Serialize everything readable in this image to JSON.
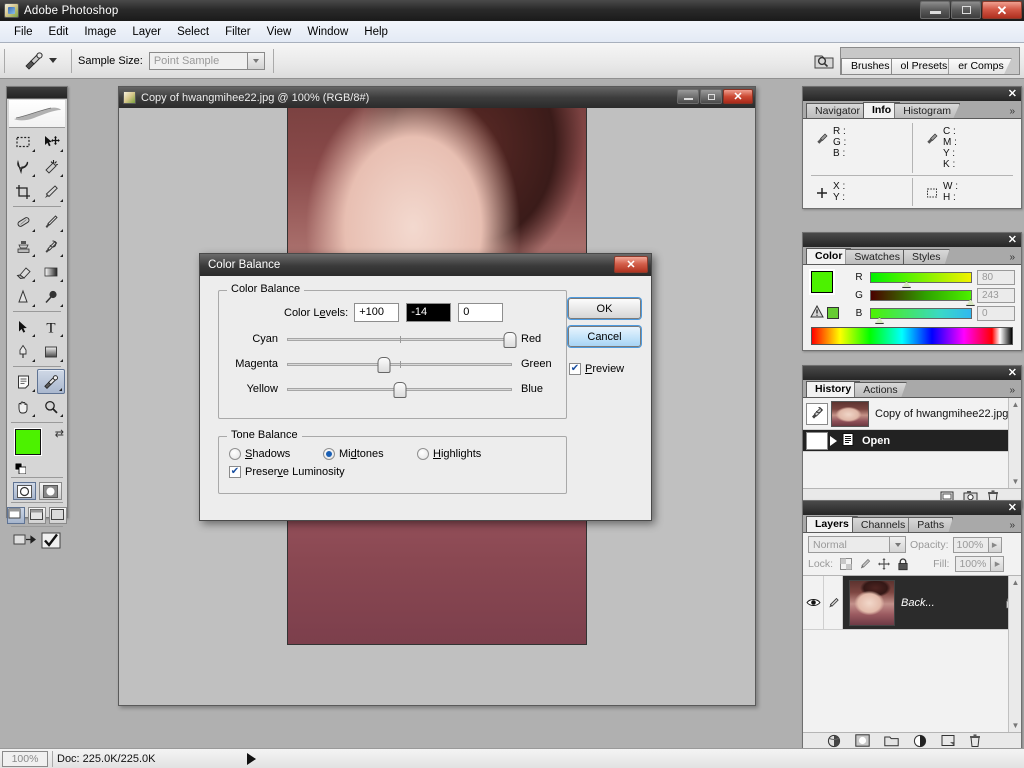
{
  "app": {
    "title": "Adobe Photoshop",
    "icon": "photoshop-icon",
    "window_controls": {
      "minimize": "minimize-icon",
      "restore": "restore-icon",
      "close": "close-icon"
    }
  },
  "menu": {
    "items": [
      {
        "label": "File"
      },
      {
        "label": "Edit"
      },
      {
        "label": "Image"
      },
      {
        "label": "Layer"
      },
      {
        "label": "Select"
      },
      {
        "label": "Filter"
      },
      {
        "label": "View"
      },
      {
        "label": "Window"
      },
      {
        "label": "Help"
      }
    ]
  },
  "options_bar": {
    "tool_icon": "eyedropper-icon",
    "sample_size_label": "Sample Size:",
    "sample_size_value": "Point Sample",
    "well_icon": "palette-well-icon",
    "well_tabs": [
      {
        "label": "Brushes"
      },
      {
        "label": "ol Presets"
      },
      {
        "label": "er Comps"
      }
    ]
  },
  "toolbox": {
    "tools": [
      {
        "name": "rectangular-marquee-tool",
        "glyph": "marquee"
      },
      {
        "name": "move-tool",
        "glyph": "move"
      },
      {
        "name": "lasso-tool",
        "glyph": "lasso"
      },
      {
        "name": "magic-wand-tool",
        "glyph": "wand"
      },
      {
        "name": "crop-tool",
        "glyph": "crop"
      },
      {
        "name": "slice-tool",
        "glyph": "slice"
      },
      {
        "name": "healing-brush-tool",
        "glyph": "heal"
      },
      {
        "name": "brush-tool",
        "glyph": "brush"
      },
      {
        "name": "clone-stamp-tool",
        "glyph": "stamp"
      },
      {
        "name": "history-brush-tool",
        "glyph": "historybrush"
      },
      {
        "name": "eraser-tool",
        "glyph": "eraser"
      },
      {
        "name": "gradient-tool",
        "glyph": "gradient"
      },
      {
        "name": "blur-tool",
        "glyph": "blur"
      },
      {
        "name": "dodge-tool",
        "glyph": "dodge"
      },
      {
        "name": "path-selection-tool",
        "glyph": "pathsel"
      },
      {
        "name": "type-tool",
        "glyph": "type"
      },
      {
        "name": "pen-tool",
        "glyph": "pen"
      },
      {
        "name": "shape-tool",
        "glyph": "shape"
      },
      {
        "name": "notes-tool",
        "glyph": "notes"
      },
      {
        "name": "eyedropper-tool",
        "glyph": "eyedropper",
        "selected": true
      },
      {
        "name": "hand-tool",
        "glyph": "hand"
      },
      {
        "name": "zoom-tool",
        "glyph": "zoom"
      }
    ],
    "foreground_color": "#4cf200",
    "background_color": "#2f7a43",
    "swap_icon": "swap-colors-icon",
    "default_icon": "default-colors-icon",
    "quickmask": [
      {
        "name": "standard-mode-button",
        "selected": true
      },
      {
        "name": "quick-mask-mode-button",
        "selected": false
      }
    ],
    "screen_modes": [
      {
        "name": "standard-screen-mode-button",
        "selected": true
      },
      {
        "name": "full-screen-menubar-button",
        "selected": false
      },
      {
        "name": "full-screen-button",
        "selected": false
      }
    ],
    "jump_buttons": [
      {
        "name": "jump-to-imageready-button"
      },
      {
        "name": "imageready-check-button"
      }
    ]
  },
  "document": {
    "title": "Copy of hwangmihee22.jpg @ 100% (RGB/8#)",
    "icon": "document-icon",
    "window_controls": {
      "minimize": "minimize-icon",
      "restore": "restore-icon",
      "close": "close-icon"
    }
  },
  "info_panel": {
    "tabs": [
      {
        "label": "Navigator",
        "active": false
      },
      {
        "label": "Info",
        "active": true
      },
      {
        "label": "Histogram",
        "active": false
      }
    ],
    "more_icon": "panel-menu-icon",
    "close_icon": "close-icon",
    "rgb": {
      "icon": "eyedropper-icon",
      "keys": [
        "R :",
        "G :",
        "B :"
      ]
    },
    "cmyk": {
      "icon": "eyedropper-icon",
      "keys": [
        "C :",
        "M :",
        "Y :",
        "K :"
      ]
    },
    "position": {
      "icon": "crosshair-icon",
      "keys": [
        "X :",
        "Y :"
      ]
    },
    "size": {
      "icon": "marquee-icon",
      "keys": [
        "W :",
        "H :"
      ]
    }
  },
  "color_panel": {
    "tabs": [
      {
        "label": "Color",
        "active": true
      },
      {
        "label": "Swatches",
        "active": false
      },
      {
        "label": "Styles",
        "active": false
      }
    ],
    "more_icon": "panel-menu-icon",
    "close_icon": "close-icon",
    "foreground_color": "#4cf200",
    "background_color": "#2f7a43",
    "gamut_warning_icon": "out-of-gamut-warning-icon",
    "gamut_swatch_color": "#66cc33",
    "channels": [
      {
        "label": "R",
        "value": "80",
        "thumb_pct": 31
      },
      {
        "label": "G",
        "value": "243",
        "thumb_pct": 95
      },
      {
        "label": "B",
        "value": "0",
        "thumb_pct": 3
      }
    ]
  },
  "history_panel": {
    "tabs": [
      {
        "label": "History",
        "active": true
      },
      {
        "label": "Actions",
        "active": false
      }
    ],
    "more_icon": "panel-menu-icon",
    "close_icon": "close-icon",
    "snapshot": {
      "label": "Copy of hwangmihee22.jpg",
      "source_icon": "history-brush-source-icon"
    },
    "states": [
      {
        "label": "Open",
        "active": true,
        "icon": "open-document-icon"
      }
    ],
    "footer_icons": [
      {
        "name": "new-document-from-state-button"
      },
      {
        "name": "new-snapshot-button"
      },
      {
        "name": "delete-state-button"
      }
    ]
  },
  "layers_panel": {
    "tabs": [
      {
        "label": "Layers",
        "active": true
      },
      {
        "label": "Channels",
        "active": false
      },
      {
        "label": "Paths",
        "active": false
      }
    ],
    "more_icon": "panel-menu-icon",
    "close_icon": "close-icon",
    "blend_mode": "Normal",
    "opacity_label": "Opacity:",
    "opacity_value": "100%",
    "lock_label": "Lock:",
    "lock_icons": [
      {
        "name": "lock-transparency-icon"
      },
      {
        "name": "lock-image-pixels-icon"
      },
      {
        "name": "lock-position-icon"
      },
      {
        "name": "lock-all-icon"
      }
    ],
    "fill_label": "Fill:",
    "fill_value": "100%",
    "layers": [
      {
        "name": "Back...",
        "visible": true,
        "locked": true,
        "thumb": "portrait-thumbnail"
      }
    ],
    "footer_icons": [
      {
        "name": "layer-style-button"
      },
      {
        "name": "layer-mask-button"
      },
      {
        "name": "new-group-button"
      },
      {
        "name": "new-adjustment-layer-button"
      },
      {
        "name": "new-layer-button"
      },
      {
        "name": "delete-layer-button"
      }
    ]
  },
  "dialog": {
    "title": "Color Balance",
    "close_icon": "close-icon",
    "color_balance_group": "Color Balance",
    "color_levels_label": "Color Levels:",
    "levels": [
      {
        "name": "cyan-red-level",
        "value": "+100",
        "selected": false
      },
      {
        "name": "magenta-green-level",
        "value": "-14",
        "selected": true
      },
      {
        "name": "yellow-blue-level",
        "value": "0",
        "selected": false
      }
    ],
    "sliders": [
      {
        "name": "cyan-red-slider",
        "left": "Cyan",
        "right": "Red",
        "pct": 100
      },
      {
        "name": "magenta-green-slider",
        "left": "Magenta",
        "right": "Green",
        "pct": 43
      },
      {
        "name": "yellow-blue-slider",
        "left": "Yellow",
        "right": "Blue",
        "pct": 50
      }
    ],
    "tone_balance_group": "Tone Balance",
    "tone_options": [
      {
        "label": "Shadows",
        "selected": false
      },
      {
        "label": "Midtones",
        "selected": true
      },
      {
        "label": "Highlights",
        "selected": false
      }
    ],
    "preserve_luminosity": {
      "label": "Preserve Luminosity",
      "checked": true
    },
    "ok_label": "OK",
    "cancel_label": "Cancel",
    "preview": {
      "label": "Preview",
      "checked": true
    }
  },
  "status_bar": {
    "zoom": "100%",
    "doc_info": "Doc: 225.0K/225.0K",
    "play_icon": "status-menu-arrow-icon"
  }
}
